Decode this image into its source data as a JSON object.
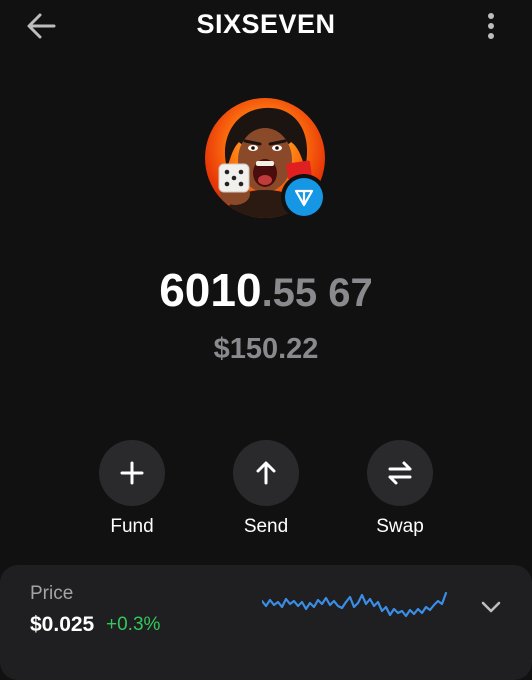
{
  "header": {
    "title": "SIXSEVEN",
    "back_icon": "arrow-left-icon",
    "menu_icon": "more-vertical-icon"
  },
  "token": {
    "avatar_icon": "token-avatar-screaming-dice",
    "network_badge_icon": "ton-icon",
    "balance_integer": "6010",
    "balance_decimal": ".55 67",
    "fiat_value": "$150.22"
  },
  "actions": [
    {
      "label": "Fund",
      "icon": "plus-icon"
    },
    {
      "label": "Send",
      "icon": "arrow-up-icon"
    },
    {
      "label": "Swap",
      "icon": "swap-arrows-icon"
    }
  ],
  "price_card": {
    "label": "Price",
    "value": "$0.025",
    "change": "+0.3%",
    "change_color": "#34c759",
    "sparkline_color": "#3a8ee6",
    "expand_icon": "chevron-down-icon"
  },
  "colors": {
    "background": "#111111",
    "muted_text": "#8a8a8e",
    "button_bg": "#2a2a2c",
    "card_bg": "#1f1f21",
    "ton_blue": "#1597e5"
  }
}
